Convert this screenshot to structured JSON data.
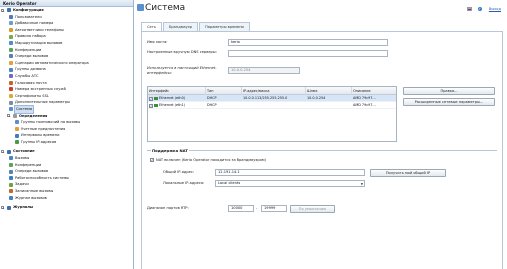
{
  "sidebar": {
    "app_title": "Kerio Operator",
    "items": [
      {
        "label": "Конфигурация",
        "level": 0,
        "group": true,
        "toggle": "−",
        "color": "#3c6fb0"
      },
      {
        "label": "Пользователи",
        "level": 1,
        "color": "#4a7cc0"
      },
      {
        "label": "Добавочные номера",
        "level": 1,
        "color": "#6c9bd2"
      },
      {
        "label": "Автоответчики телефоны",
        "level": 1,
        "color": "#d89b2f"
      },
      {
        "label": "Правила набора",
        "level": 1,
        "color": "#7aa84a"
      },
      {
        "label": "Маршрутизация вызовов",
        "level": 1,
        "color": "#4b8ecc"
      },
      {
        "label": "Конференции",
        "level": 1,
        "color": "#5fa15f"
      },
      {
        "label": "Очереди вызовов",
        "level": 1,
        "color": "#5a7fb5"
      },
      {
        "label": "Сценарии автоматического оператора",
        "level": 1,
        "color": "#e0a03a"
      },
      {
        "label": "Группы дозвона",
        "level": 1,
        "color": "#4a86c5"
      },
      {
        "label": "Службы АТС",
        "level": 1,
        "color": "#6c6cc9"
      },
      {
        "label": "Голосовая почта",
        "level": 1,
        "color": "#c7642a"
      },
      {
        "label": "Номера экстренных служб",
        "level": 1,
        "color": "#d33a2a"
      },
      {
        "label": "Сертификаты SSL",
        "level": 1,
        "color": "#d9a93a"
      },
      {
        "label": "Дополнительные параметры",
        "level": 1,
        "color": "#7b8da4"
      },
      {
        "label": "Система",
        "level": 1,
        "color": "#5b8fd0",
        "selected": true
      },
      {
        "label": "Определения",
        "level": 1,
        "group": true,
        "toggle": "−",
        "color": "#9a9a9a"
      },
      {
        "label": "Группы полномочий на вызовы",
        "level": 2,
        "color": "#5b8fd0"
      },
      {
        "label": "Учетные предпочтения",
        "level": 2,
        "color": "#e0a03a"
      },
      {
        "label": "Интервалы времени",
        "level": 2,
        "color": "#3b7fc4"
      },
      {
        "label": "Группы IP-адресов",
        "level": 2,
        "color": "#4a9a4a"
      },
      {
        "label": "",
        "level": 1,
        "spacer": true
      },
      {
        "label": "Состояние",
        "level": 0,
        "group": true,
        "toggle": "−",
        "color": "#3c6fb0"
      },
      {
        "label": "Вызовы",
        "level": 1,
        "color": "#4a86c5"
      },
      {
        "label": "Конференции",
        "level": 1,
        "color": "#5fa15f"
      },
      {
        "label": "Очереди вызовов",
        "level": 1,
        "color": "#5a7fb5"
      },
      {
        "label": "Работоспособность системы",
        "level": 1,
        "color": "#3b7fc4"
      },
      {
        "label": "Задачи",
        "level": 1,
        "color": "#6aa24a"
      },
      {
        "label": "Записанные вызовы",
        "level": 1,
        "color": "#c7642a"
      },
      {
        "label": "Журнал вызовов",
        "level": 1,
        "color": "#4a7cc0"
      },
      {
        "label": "",
        "level": 1,
        "spacer": true
      },
      {
        "label": "Журналы",
        "level": 0,
        "group": true,
        "toggle": "+",
        "color": "#3c6fb0"
      }
    ]
  },
  "header": {
    "title": "Система",
    "help_glyph": "?",
    "exit_label": "Выход"
  },
  "tabs": [
    {
      "label": "Сеть",
      "active": true
    },
    {
      "label": "Брандмауэр",
      "active": false
    },
    {
      "label": "Параметры времени",
      "active": false
    }
  ],
  "form": {
    "hostname_label": "Имя хоста:",
    "hostname_value": "kerio",
    "dns_label": "Настроенные вручную DNS серверы:",
    "dns_value": "",
    "interface_label": "Используется в настоящий Ethernet-интерфейсы:",
    "interface_value": "10.0.0.254"
  },
  "interfaces_table": {
    "columns": [
      "Интерфейс",
      "Тип",
      "IP-адрес/маска",
      "Шлюз",
      "Описание"
    ],
    "rows": [
      {
        "interface": "Ethernet (eth0)",
        "type": "DHCP",
        "ip": "10.0.0.113/255.255.255.0",
        "gateway": "10.0.0.254",
        "description": "AMD 79c97...",
        "checked": true,
        "selected": true
      },
      {
        "interface": "Ethernet (eth1)",
        "type": "DHCP",
        "ip": "",
        "gateway": "",
        "description": "AMD 79c97...",
        "checked": true,
        "selected": false
      }
    ]
  },
  "buttons": {
    "edit": "Правка...",
    "advanced": "Расширенные сетевые параметры...",
    "public_ip": "Получить мой общий IP",
    "default": "По умолчанию"
  },
  "nat": {
    "legend": "Поддержка NAT",
    "enabled_label": "NAT включен (Kerio Operator находится за брандмауэром)",
    "enabled": true,
    "public_ip_label": "Общий IP-адрес:",
    "public_ip_value": "12.191.14.1",
    "local_addresses_label": "Локальные IP-адреса:",
    "local_addresses_value": "Local clients"
  },
  "rtp": {
    "label": "Диапазон портов RTP:",
    "from": "10000",
    "dash": "-",
    "to": "19999"
  }
}
